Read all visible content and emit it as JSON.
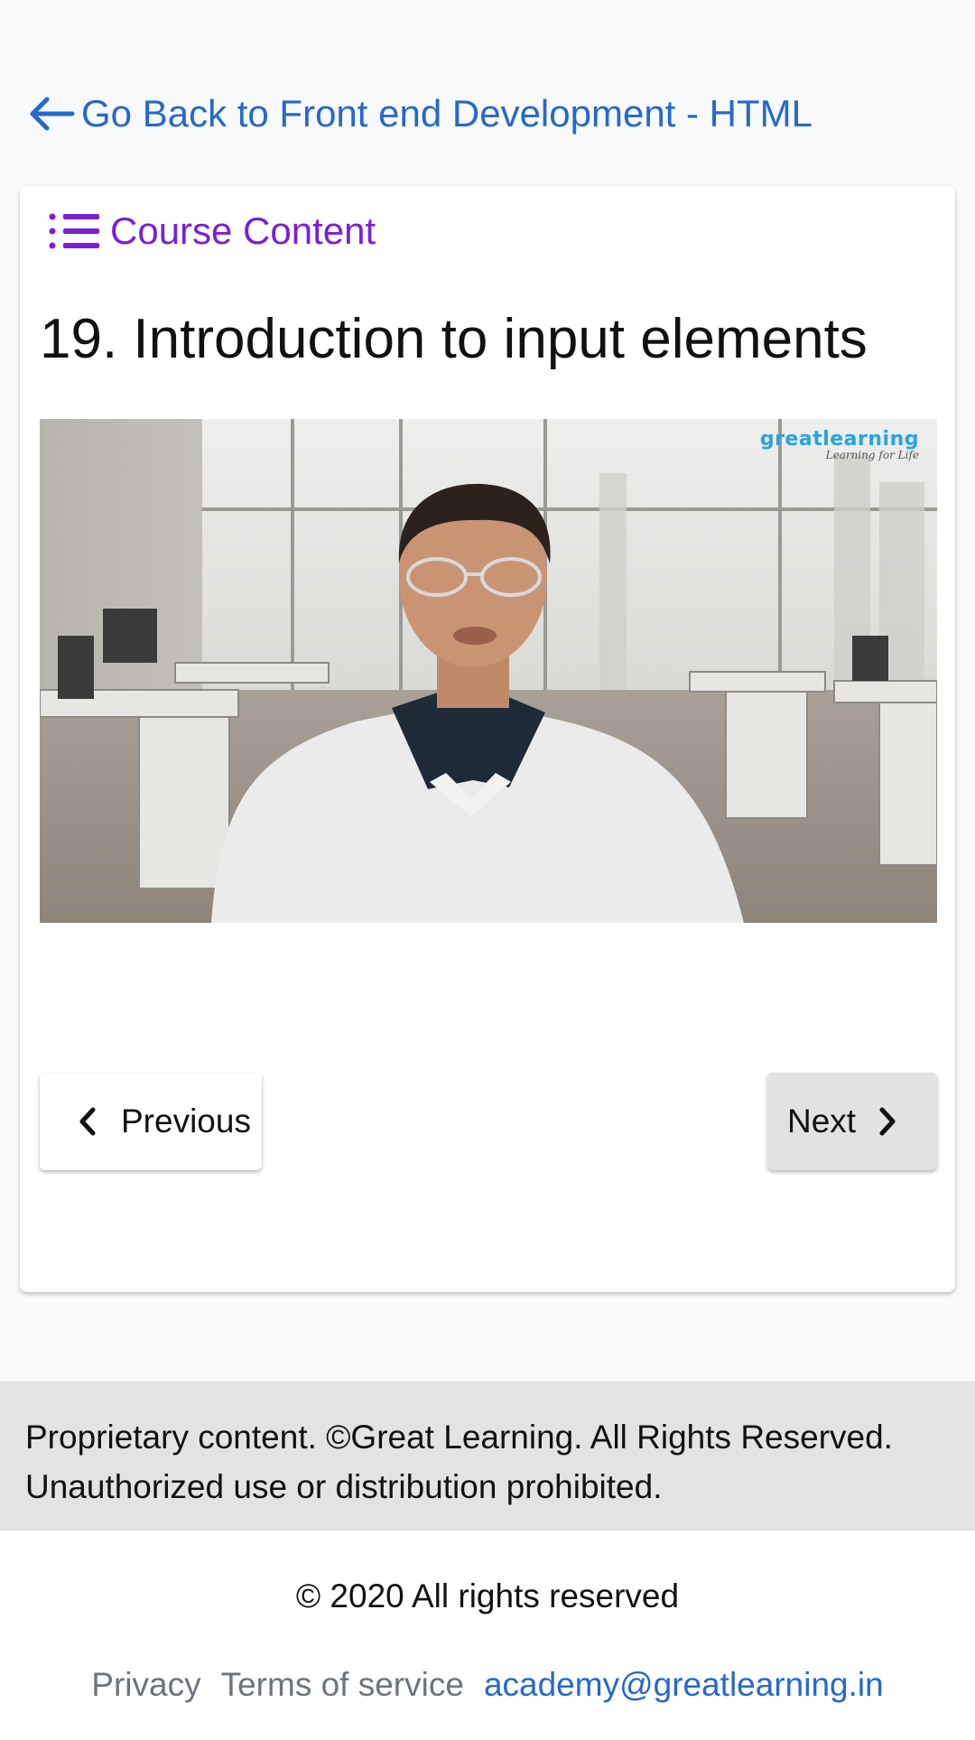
{
  "nav": {
    "back_link": "Go Back to Front end Development - HTML"
  },
  "card": {
    "course_content_label": "Course Content",
    "lesson_title": "19. Introduction to input elements",
    "video": {
      "brand_part1": "great",
      "brand_part2": "learning",
      "brand_tagline": "Learning for Life"
    },
    "prev_label": "Previous",
    "next_label": "Next"
  },
  "notice": {
    "line1": "Proprietary content. ©Great Learning. All Rights Reserved.",
    "line2": "Unauthorized use or distribution prohibited."
  },
  "footer": {
    "copyright": "© 2020 All rights reserved",
    "links": {
      "privacy": "Privacy",
      "terms": "Terms of service",
      "email": "academy@greatlearning.in"
    }
  },
  "colors": {
    "link_blue": "#2569c9",
    "accent_purple": "#7a1fd6",
    "notice_bg": "#e2e3e5",
    "next_btn_bg": "#e2e2e2"
  }
}
